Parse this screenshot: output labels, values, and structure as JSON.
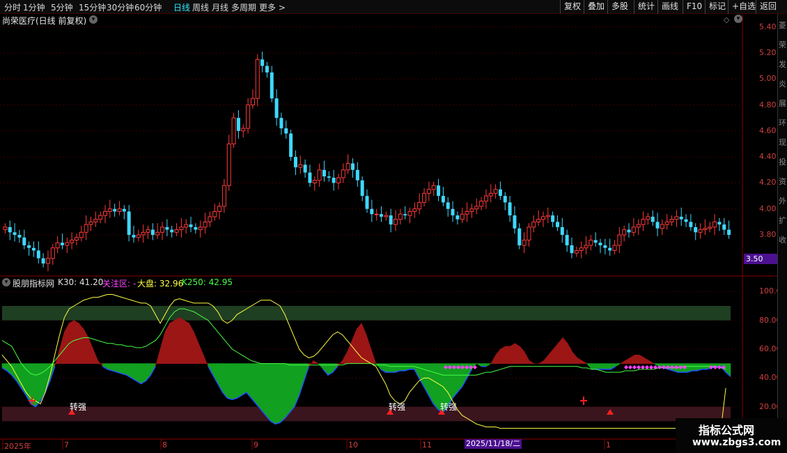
{
  "toolbar": {
    "periods": [
      "分时",
      "1分钟",
      "5分钟",
      "15分钟",
      "30分钟",
      "60分钟",
      "日线",
      "周线",
      "月线",
      "多周期",
      "更多 >"
    ],
    "active_period": "日线",
    "right_buttons": [
      "复权",
      "叠加",
      "多股",
      "统计",
      "画线",
      "F10",
      "标记",
      "+自选",
      "返回"
    ]
  },
  "main_chart": {
    "title": "尚荣医疗(日线 前复权)",
    "price_axis": [
      "5.40",
      "5.20",
      "5.00",
      "4.80",
      "4.60",
      "4.40",
      "4.20",
      "4.00",
      "3.80"
    ],
    "current_price_tag": "3.50",
    "colors": {
      "up": "#ff3b3b",
      "down": "#3fd8ff",
      "grid": "#5a0000"
    }
  },
  "indicator": {
    "name": "股朋指标网",
    "items": [
      {
        "label": "K30: 41.20",
        "color": "#e0e0e0"
      },
      {
        "label": "关注区: -",
        "color": "#ff44ff"
      },
      {
        "label": "大盘: 32.96",
        "color": "#ffff44"
      },
      {
        "label": "K250: 42.95",
        "color": "#44ff44"
      }
    ],
    "axis": [
      "100.0",
      "80.00",
      "60.00",
      "40.00",
      "20.00"
    ],
    "signal_label": "转强"
  },
  "date_axis": [
    "2025年",
    "7",
    "8",
    "9",
    "10",
    "11",
    "1"
  ],
  "date_cursor": "2025/11/18/二",
  "sidebar_chars": [
    "菱",
    "荣",
    "发",
    "炎",
    "展",
    "环",
    "现",
    "投",
    "资",
    "外",
    "扩",
    "收"
  ],
  "watermark": {
    "line1": "指标公式网",
    "line2": "www.zbgs3.com"
  },
  "chart_data": [
    {
      "type": "candlestick",
      "title": "尚荣医疗(日线 前复权)",
      "xlabel": "",
      "ylabel": "",
      "ylim": [
        3.5,
        5.5
      ],
      "dates_shown": [
        "2025年",
        "7",
        "8",
        "9",
        "10",
        "11",
        "2025/11/18/二",
        "1"
      ],
      "close_approx": [
        3.86,
        3.82,
        3.8,
        3.78,
        3.72,
        3.7,
        3.68,
        3.62,
        3.58,
        3.62,
        3.7,
        3.74,
        3.72,
        3.74,
        3.76,
        3.78,
        3.82,
        3.88,
        3.9,
        3.92,
        3.95,
        3.98,
        4.0,
        3.98,
        4.0,
        3.98,
        3.8,
        3.78,
        3.8,
        3.82,
        3.84,
        3.8,
        3.82,
        3.86,
        3.84,
        3.82,
        3.84,
        3.86,
        3.88,
        3.86,
        3.84,
        3.86,
        3.9,
        3.94,
        3.98,
        4.02,
        4.18,
        4.5,
        4.7,
        4.6,
        4.62,
        4.8,
        4.85,
        5.15,
        5.1,
        5.05,
        4.85,
        4.7,
        4.62,
        4.58,
        4.4,
        4.32,
        4.34,
        4.28,
        4.2,
        4.22,
        4.3,
        4.25,
        4.24,
        4.2,
        4.24,
        4.3,
        4.35,
        4.3,
        4.22,
        4.1,
        4.0,
        3.96,
        3.96,
        3.94,
        3.95,
        3.88,
        3.92,
        3.96,
        3.95,
        3.98,
        4.0,
        4.05,
        4.12,
        4.15,
        4.18,
        4.1,
        4.05,
        4.0,
        3.95,
        3.92,
        3.96,
        3.98,
        4.0,
        4.02,
        4.06,
        4.1,
        4.12,
        4.15,
        4.1,
        4.05,
        3.95,
        3.85,
        3.72,
        3.76,
        3.86,
        3.9,
        3.92,
        3.94,
        3.95,
        3.9,
        3.86,
        3.8,
        3.72,
        3.66,
        3.68,
        3.7,
        3.72,
        3.76,
        3.74,
        3.72,
        3.7,
        3.68,
        3.72,
        3.8,
        3.84,
        3.82,
        3.86,
        3.88,
        3.92,
        3.94,
        3.9,
        3.85,
        3.88,
        3.9,
        3.92,
        3.94,
        3.92,
        3.9,
        3.86,
        3.82,
        3.84,
        3.85,
        3.86,
        3.9,
        3.88,
        3.84,
        3.8
      ]
    },
    {
      "type": "area",
      "title": "股朋指标网",
      "xlabel": "",
      "ylabel": "",
      "ylim": [
        0,
        105
      ],
      "series": [
        {
          "name": "K30",
          "color": "#e0e0e0",
          "values": [
            47,
            45,
            42,
            38,
            33,
            28,
            22,
            20,
            24,
            30,
            38,
            48,
            60,
            72,
            78,
            80,
            78,
            74,
            68,
            60,
            52,
            48,
            46,
            45,
            44,
            43,
            42,
            40,
            38,
            36,
            38,
            42,
            48,
            60,
            72,
            78,
            80,
            82,
            80,
            78,
            72,
            64,
            56,
            48,
            42,
            36,
            30,
            26,
            25,
            26,
            28,
            30,
            26,
            22,
            18,
            14,
            10,
            8,
            9,
            12,
            16,
            20,
            28,
            38,
            48,
            52,
            50,
            46,
            42,
            44,
            48,
            52,
            58,
            66,
            74,
            78,
            70,
            60,
            50,
            46,
            44,
            44,
            44,
            45,
            45,
            46,
            46,
            40,
            34,
            28,
            22,
            18,
            16,
            20,
            26,
            30,
            34,
            40,
            46,
            50,
            48,
            48,
            50,
            56,
            60,
            62,
            62,
            64,
            62,
            58,
            52,
            50,
            50,
            52,
            56,
            60,
            64,
            68,
            64,
            58,
            54,
            52,
            50,
            46,
            46,
            46,
            46,
            46,
            48,
            50,
            52,
            54,
            56,
            56,
            54,
            52,
            50,
            48,
            47,
            46,
            45,
            44,
            44,
            44,
            45,
            45,
            46,
            46,
            47,
            48,
            48,
            44,
            41
          ]
        },
        {
          "name": "大盘",
          "color": "#ffff44",
          "values": [
            56,
            52,
            48,
            42,
            36,
            30,
            26,
            24,
            22,
            30,
            42,
            56,
            70,
            82,
            88,
            90,
            92,
            94,
            95,
            96,
            96,
            97,
            98,
            98,
            97,
            96,
            95,
            94,
            93,
            92,
            92,
            90,
            84,
            78,
            84,
            90,
            94,
            95,
            94,
            93,
            92,
            92,
            92,
            92,
            90,
            86,
            80,
            78,
            80,
            84,
            86,
            88,
            90,
            92,
            94,
            94,
            94,
            92,
            90,
            84,
            76,
            68,
            60,
            56,
            54,
            55,
            58,
            62,
            66,
            70,
            72,
            70,
            66,
            62,
            58,
            54,
            52,
            50,
            48,
            42,
            36,
            28,
            24,
            22,
            24,
            30,
            34,
            38,
            40,
            40,
            38,
            36,
            34,
            30,
            24,
            18,
            14,
            12,
            10,
            8,
            7,
            6,
            6,
            6,
            5,
            5,
            5,
            5,
            5,
            5,
            5,
            5,
            5,
            5,
            5,
            5,
            5,
            5,
            5,
            5,
            5,
            5,
            5,
            5,
            5,
            5,
            5,
            5,
            5,
            5,
            5,
            5,
            5,
            5,
            5,
            5,
            5,
            5,
            5,
            5,
            5,
            5,
            5,
            5,
            5,
            5,
            5,
            5,
            5,
            5,
            5,
            33
          ]
        },
        {
          "name": "K250",
          "color": "#44ff44",
          "values": [
            66,
            64,
            62,
            56,
            50,
            46,
            43,
            42,
            43,
            45,
            48,
            52,
            56,
            60,
            64,
            66,
            67,
            68,
            68,
            67,
            66,
            65,
            64,
            64,
            63,
            63,
            62,
            62,
            61,
            61,
            62,
            64,
            66,
            70,
            76,
            82,
            86,
            88,
            88,
            87,
            86,
            84,
            82,
            80,
            76,
            72,
            68,
            64,
            60,
            58,
            56,
            54,
            52,
            51,
            50,
            50,
            50,
            50,
            50,
            50,
            49,
            49,
            49,
            49,
            49,
            49,
            49,
            49,
            49,
            49,
            49,
            49,
            50,
            50,
            50,
            50,
            50,
            50,
            49,
            49,
            49,
            48,
            48,
            48,
            48,
            48,
            48,
            47,
            46,
            45,
            44,
            43,
            42,
            42,
            42,
            42,
            42,
            42,
            42,
            42,
            43,
            44,
            44,
            45,
            46,
            47,
            48,
            48,
            48,
            48,
            48,
            48,
            48,
            48,
            48,
            48,
            48,
            48,
            48,
            48,
            48,
            47,
            47,
            46,
            46,
            45,
            44,
            44,
            44,
            44,
            45,
            45,
            45,
            46,
            46,
            46,
            46,
            47,
            47,
            47,
            47,
            47,
            48,
            48,
            48,
            48,
            48,
            48,
            48,
            48,
            47,
            46
          ]
        }
      ]
    }
  ]
}
